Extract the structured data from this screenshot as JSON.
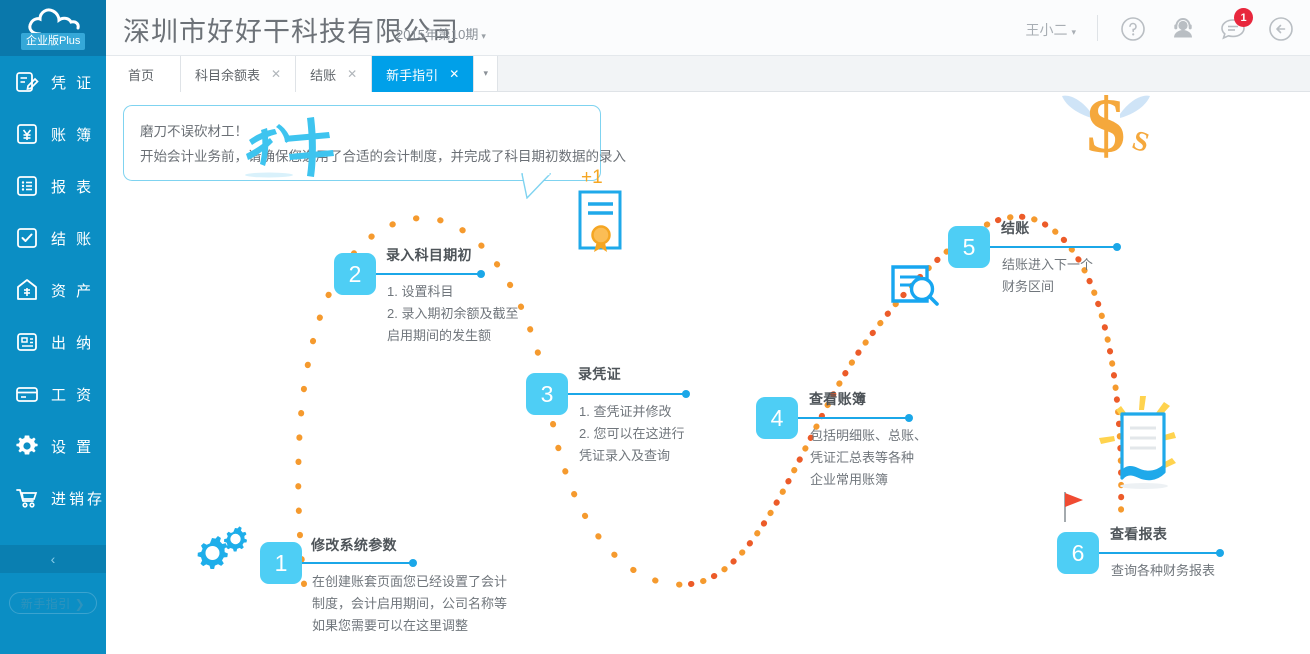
{
  "sidebar": {
    "logo": {
      "icon": "cloud-icon",
      "badge": "企业版Plus"
    },
    "items": [
      {
        "label": "凭 证",
        "icon": "voucher-icon"
      },
      {
        "label": "账 簿",
        "icon": "ledger-icon"
      },
      {
        "label": "报 表",
        "icon": "report-icon"
      },
      {
        "label": "结 账",
        "icon": "checkout-icon"
      },
      {
        "label": "资 产",
        "icon": "assets-icon"
      },
      {
        "label": "出 纳",
        "icon": "cashier-icon"
      },
      {
        "label": "工 资",
        "icon": "payroll-icon"
      },
      {
        "label": "设 置",
        "icon": "gear-icon"
      },
      {
        "label": "进销存",
        "icon": "inventory-icon"
      }
    ],
    "collapse": "‹",
    "guide_pill": "新手指引 ❯"
  },
  "header": {
    "company": "深圳市好好干科技有限公司",
    "period": "2015年第10期",
    "period_caret": "▾",
    "user": "王小二",
    "user_caret": "▾",
    "icons": [
      "help-icon",
      "support-icon",
      "message-icon",
      "exit-icon"
    ],
    "message_badge": "1"
  },
  "tabs": [
    {
      "label": "首页",
      "closable": false,
      "active": false
    },
    {
      "label": "科目余额表",
      "closable": true,
      "active": false,
      "close": "✕"
    },
    {
      "label": "结账",
      "closable": true,
      "active": false,
      "close": "✕"
    },
    {
      "label": "新手指引",
      "closable": true,
      "active": true,
      "close": "✕"
    }
  ],
  "tab_more": "▾",
  "bubble": {
    "line1": "磨刀不误砍材工！",
    "line2": "开始会计业务前，请确保您选用了合适的会计制度，并完成了科目期初数据的录入"
  },
  "steps": [
    {
      "number": "1",
      "title": "修改系统参数",
      "lines": [
        "在创建账套页面您已经设置了会计",
        "制度，会计启用期间，公司名称等",
        "如果您需要可以在这里调整"
      ],
      "icon": "gears-icon"
    },
    {
      "number": "2",
      "title": "录入科目期初",
      "lines": [
        "1. 设置科目",
        "2. 录入期初余额及截至",
        "启用期间的发生额"
      ],
      "icon": "calligraphy-ke-icon"
    },
    {
      "number": "3",
      "title": "录凭证",
      "lines": [
        "1. 查凭证并修改",
        "2. 您可以在这进行",
        "凭证录入及查询"
      ],
      "icon": "certificate-icon",
      "icon_label": "+1"
    },
    {
      "number": "4",
      "title": "查看账簿",
      "lines": [
        "包括明细账、总账、",
        "凭证汇总表等各种",
        "企业常用账簿"
      ],
      "icon": "document-search-icon"
    },
    {
      "number": "5",
      "title": "结账",
      "lines": [
        "结账进入下一个",
        "财务区间"
      ],
      "icon": "flying-money-icon"
    },
    {
      "number": "6",
      "title": "查看报表",
      "lines": [
        "查询各种财务报表"
      ],
      "icon": "report-sparkle-icon"
    }
  ],
  "colors": {
    "sidebar": "#0b8ec4",
    "sidebar_logo": "#0a78ab",
    "accent": "#00a0e9",
    "badge_blue": "#4ecef5",
    "path_orange": "#f59a2e",
    "path_red": "#ec5b29",
    "notify_red": "#e8273d"
  }
}
